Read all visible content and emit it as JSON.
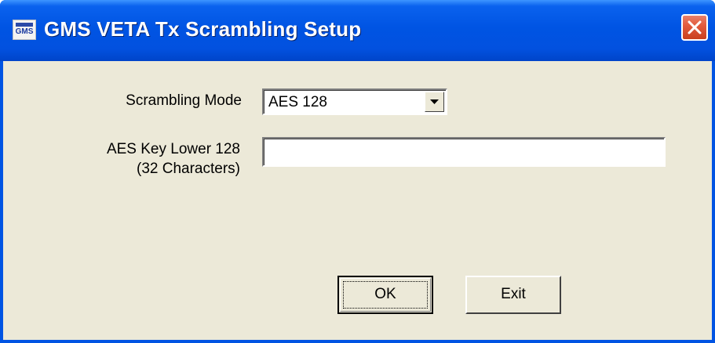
{
  "window": {
    "title": "GMS VETA Tx Scrambling Setup",
    "app_icon_text": "GMS"
  },
  "form": {
    "scrambling_mode_label": "Scrambling Mode",
    "scrambling_mode_value": "AES 128",
    "aes_key_label_line1": "AES Key Lower 128",
    "aes_key_label_line2": "(32 Characters)",
    "aes_key_value": ""
  },
  "buttons": {
    "ok_label": "OK",
    "exit_label": "Exit"
  },
  "colors": {
    "titlebar": "#0054e3",
    "dialog_face": "#ece9d8",
    "close_button": "#e35c3e"
  }
}
